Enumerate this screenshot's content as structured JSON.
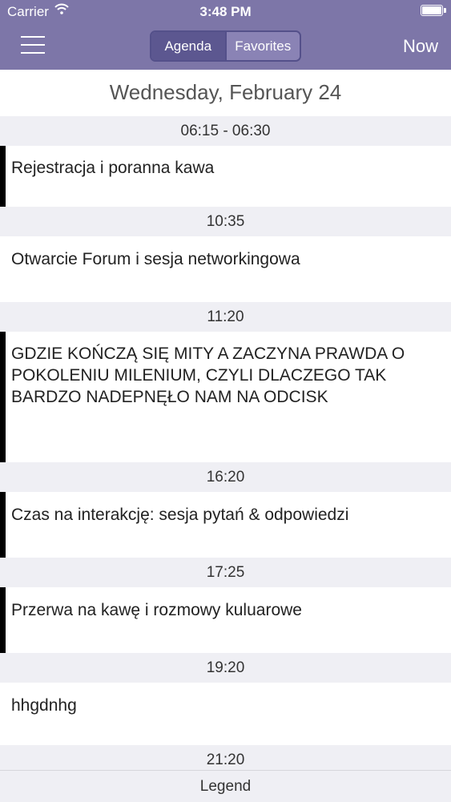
{
  "status_bar": {
    "carrier": "Carrier",
    "time": "3:48 PM"
  },
  "nav": {
    "segments": [
      "Agenda",
      "Favorites"
    ],
    "active_segment": "Agenda",
    "now_label": "Now"
  },
  "date_header": "Wednesday, February 24",
  "schedule": [
    {
      "time": "06:15 - 06:30",
      "title": "Rejestracja i poranna kawa",
      "favorite": true
    },
    {
      "time": "10:35",
      "title": "Otwarcie Forum i sesja networkingowa",
      "favorite": false
    },
    {
      "time": "11:20",
      "title": "GDZIE KOŃCZĄ SIĘ MITY A ZACZYNA PRAWDA O POKOLENIU MILENIUM, CZYLI DLACZEGO TAK BARDZO NADEPNĘŁO NAM NA ODCISK",
      "favorite": true
    },
    {
      "time": "16:20",
      "title": "Czas na interakcję: sesja pytań & odpowiedzi",
      "favorite": true
    },
    {
      "time": "17:25",
      "title": "Przerwa na kawę i rozmowy kuluarowe",
      "favorite": true
    },
    {
      "time": "19:20",
      "title": "hhgdnhg",
      "favorite": false
    },
    {
      "time": "21:20"
    }
  ],
  "legend_label": "Legend",
  "colors": {
    "nav_bar": "#7d76a8",
    "favorite_marker": "#000000",
    "section_bg": "#efeff4"
  }
}
